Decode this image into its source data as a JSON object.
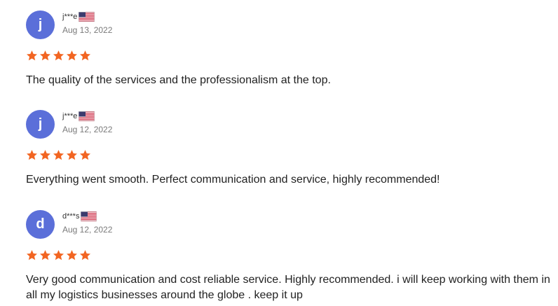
{
  "reviews": [
    {
      "avatar_letter": "j",
      "username": "j***e",
      "country_flag_icon": "us-flag-icon",
      "date": "Aug 13, 2022",
      "rating": 5,
      "rating_max": 5,
      "text": "The quality of the services and the professionalism at the top."
    },
    {
      "avatar_letter": "j",
      "username": "j***e",
      "country_flag_icon": "us-flag-icon",
      "date": "Aug 12, 2022",
      "rating": 5,
      "rating_max": 5,
      "text": "Everything went smooth. Perfect communication and service, highly recommended!"
    },
    {
      "avatar_letter": "d",
      "username": "d***s",
      "country_flag_icon": "us-flag-icon",
      "date": "Aug 12, 2022",
      "rating": 5,
      "rating_max": 5,
      "text": "Very good communication and cost reliable service. Highly recommended. i will keep working with them in all my logistics businesses around the globe . keep it up"
    }
  ],
  "colors": {
    "avatar": "#5b6fd9",
    "star": "#f26522",
    "date": "#7a7a7a",
    "text": "#222222"
  }
}
